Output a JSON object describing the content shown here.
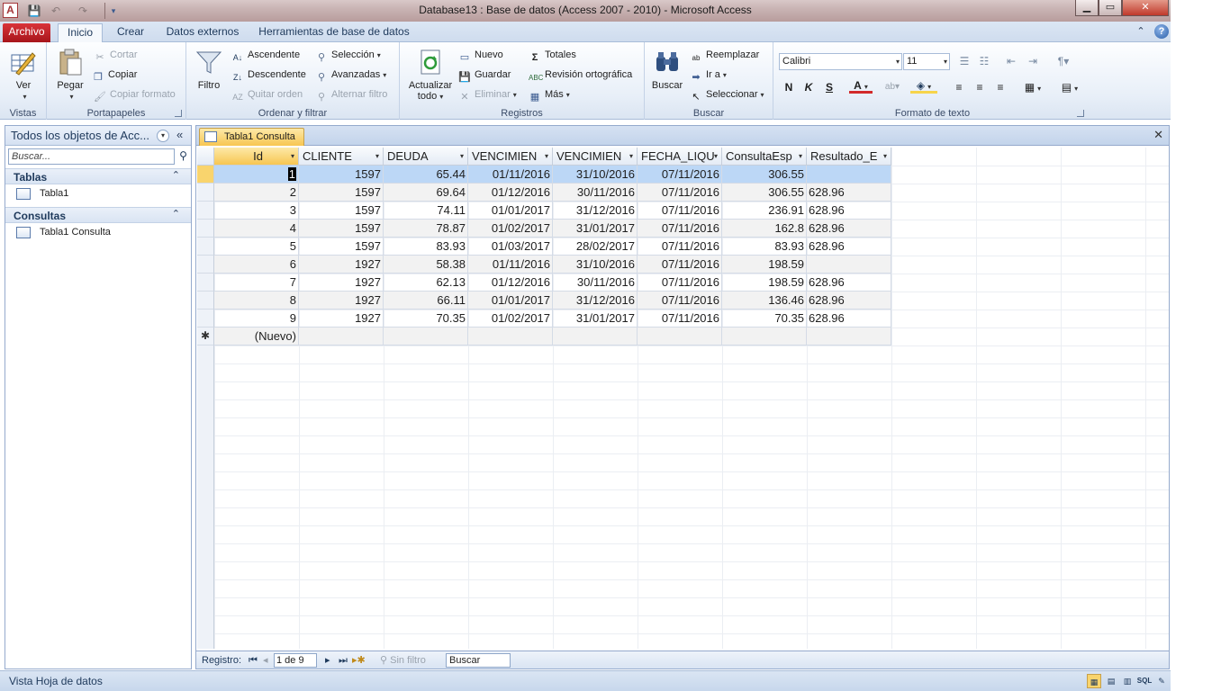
{
  "window": {
    "title": "Database13 : Base de datos (Access 2007 - 2010)  -  Microsoft Access",
    "app_icon": "A",
    "minimize": "▁",
    "maximize": "▭",
    "close": "✕"
  },
  "ribbon_tabs": [
    "Archivo",
    "Inicio",
    "Crear",
    "Datos externos",
    "Herramientas de base de datos"
  ],
  "ribbon": {
    "vistas": {
      "label": "Vistas",
      "ver": "Ver"
    },
    "portapapeles": {
      "label": "Portapapeles",
      "pegar": "Pegar",
      "cortar": "Cortar",
      "copiar": "Copiar",
      "copiar_formato": "Copiar formato"
    },
    "ordenar": {
      "label": "Ordenar y filtrar",
      "filtro": "Filtro",
      "ascendente": "Ascendente",
      "descendente": "Descendente",
      "quitar_orden": "Quitar orden",
      "seleccion": "Selección",
      "avanzadas": "Avanzadas",
      "alternar_filtro": "Alternar filtro"
    },
    "registros": {
      "label": "Registros",
      "actualizar": "Actualizar",
      "todo": "todo",
      "nuevo": "Nuevo",
      "guardar": "Guardar",
      "eliminar": "Eliminar",
      "totales": "Totales",
      "revision": "Revisión ortográfica",
      "mas": "Más"
    },
    "buscar": {
      "label": "Buscar",
      "buscar": "Buscar",
      "reemplazar": "Reemplazar",
      "ira": "Ir a",
      "seleccionar": "Seleccionar"
    },
    "formato": {
      "label": "Formato de texto",
      "font": "Calibri",
      "size": "11",
      "bold": "N",
      "italic": "K",
      "underline": "S"
    }
  },
  "nav": {
    "title": "Todos los objetos de Acc...",
    "search_placeholder": "Buscar...",
    "sections": [
      {
        "label": "Tablas",
        "items": [
          "Tabla1"
        ]
      },
      {
        "label": "Consultas",
        "items": [
          "Tabla1 Consulta"
        ]
      }
    ]
  },
  "document": {
    "tab_label": "Tabla1 Consulta",
    "columns": [
      "Id",
      "CLIENTE",
      "DEUDA",
      "VENCIMIEN",
      "VENCIMIEN",
      "FECHA_LIQU",
      "ConsultaEsp",
      "Resultado_E"
    ],
    "rows": [
      [
        "1",
        "1597",
        "65.44",
        "01/11/2016",
        "31/10/2016",
        "07/11/2016",
        "306.55",
        ""
      ],
      [
        "2",
        "1597",
        "69.64",
        "01/12/2016",
        "30/11/2016",
        "07/11/2016",
        "306.55",
        "628.96"
      ],
      [
        "3",
        "1597",
        "74.11",
        "01/01/2017",
        "31/12/2016",
        "07/11/2016",
        "236.91",
        "628.96"
      ],
      [
        "4",
        "1597",
        "78.87",
        "01/02/2017",
        "31/01/2017",
        "07/11/2016",
        "162.8",
        "628.96"
      ],
      [
        "5",
        "1597",
        "83.93",
        "01/03/2017",
        "28/02/2017",
        "07/11/2016",
        "83.93",
        "628.96"
      ],
      [
        "6",
        "1927",
        "58.38",
        "01/11/2016",
        "31/10/2016",
        "07/11/2016",
        "198.59",
        ""
      ],
      [
        "7",
        "1927",
        "62.13",
        "01/12/2016",
        "30/11/2016",
        "07/11/2016",
        "198.59",
        "628.96"
      ],
      [
        "8",
        "1927",
        "66.11",
        "01/01/2017",
        "31/12/2016",
        "07/11/2016",
        "136.46",
        "628.96"
      ],
      [
        "9",
        "1927",
        "70.35",
        "01/02/2017",
        "31/01/2017",
        "07/11/2016",
        "70.35",
        "628.96"
      ]
    ],
    "new_row_label": "(Nuevo)",
    "new_row_marker": "✱"
  },
  "recnav": {
    "label": "Registro:",
    "position": "1 de 9",
    "filter": "Sin filtro",
    "search": "Buscar"
  },
  "status": {
    "text": "Vista Hoja de datos",
    "sql": "SQL"
  }
}
